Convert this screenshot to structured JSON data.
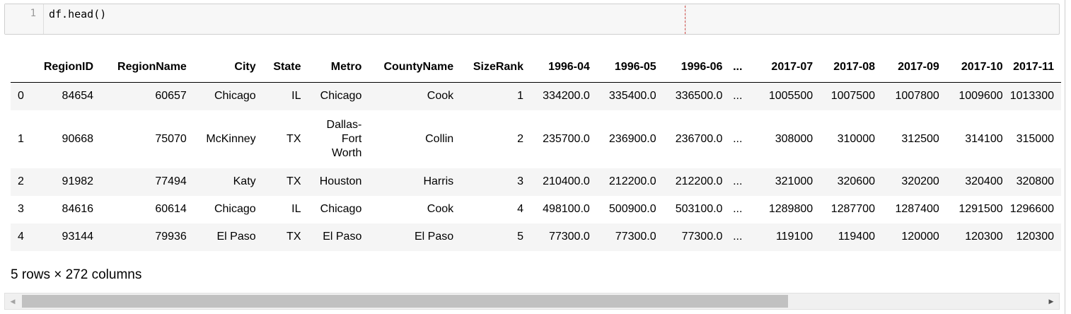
{
  "input_cell": {
    "line_number": "1",
    "code": "df.head()"
  },
  "table": {
    "columns": [
      "",
      "RegionID",
      "RegionName",
      "City",
      "State",
      "Metro",
      "CountyName",
      "SizeRank",
      "1996-04",
      "1996-05",
      "1996-06",
      "...",
      "2017-07",
      "2017-08",
      "2017-09",
      "2017-10",
      "2017-11"
    ],
    "rows": [
      [
        "0",
        "84654",
        "60657",
        "Chicago",
        "IL",
        "Chicago",
        "Cook",
        "1",
        "334200.0",
        "335400.0",
        "336500.0",
        "...",
        "1005500",
        "1007500",
        "1007800",
        "1009600",
        "1013300"
      ],
      [
        "1",
        "90668",
        "75070",
        "McKinney",
        "TX",
        "Dallas-Fort Worth",
        "Collin",
        "2",
        "235700.0",
        "236900.0",
        "236700.0",
        "...",
        "308000",
        "310000",
        "312500",
        "314100",
        "315000"
      ],
      [
        "2",
        "91982",
        "77494",
        "Katy",
        "TX",
        "Houston",
        "Harris",
        "3",
        "210400.0",
        "212200.0",
        "212200.0",
        "...",
        "321000",
        "320600",
        "320200",
        "320400",
        "320800"
      ],
      [
        "3",
        "84616",
        "60614",
        "Chicago",
        "IL",
        "Chicago",
        "Cook",
        "4",
        "498100.0",
        "500900.0",
        "503100.0",
        "...",
        "1289800",
        "1287700",
        "1287400",
        "1291500",
        "1296600"
      ],
      [
        "4",
        "93144",
        "79936",
        "El Paso",
        "TX",
        "El Paso",
        "El Paso",
        "5",
        "77300.0",
        "77300.0",
        "77300.0",
        "...",
        "119100",
        "119400",
        "120000",
        "120300",
        "120300"
      ]
    ],
    "metro_wrap": [
      "Dallas-",
      "Fort",
      "Worth"
    ]
  },
  "footer": "5 rows × 272 columns",
  "scrollbar": {
    "left_arrow_icon": "triangle-left",
    "right_arrow_icon": "triangle-right",
    "position_fraction": 0.0,
    "thumb_fraction": 0.75
  }
}
